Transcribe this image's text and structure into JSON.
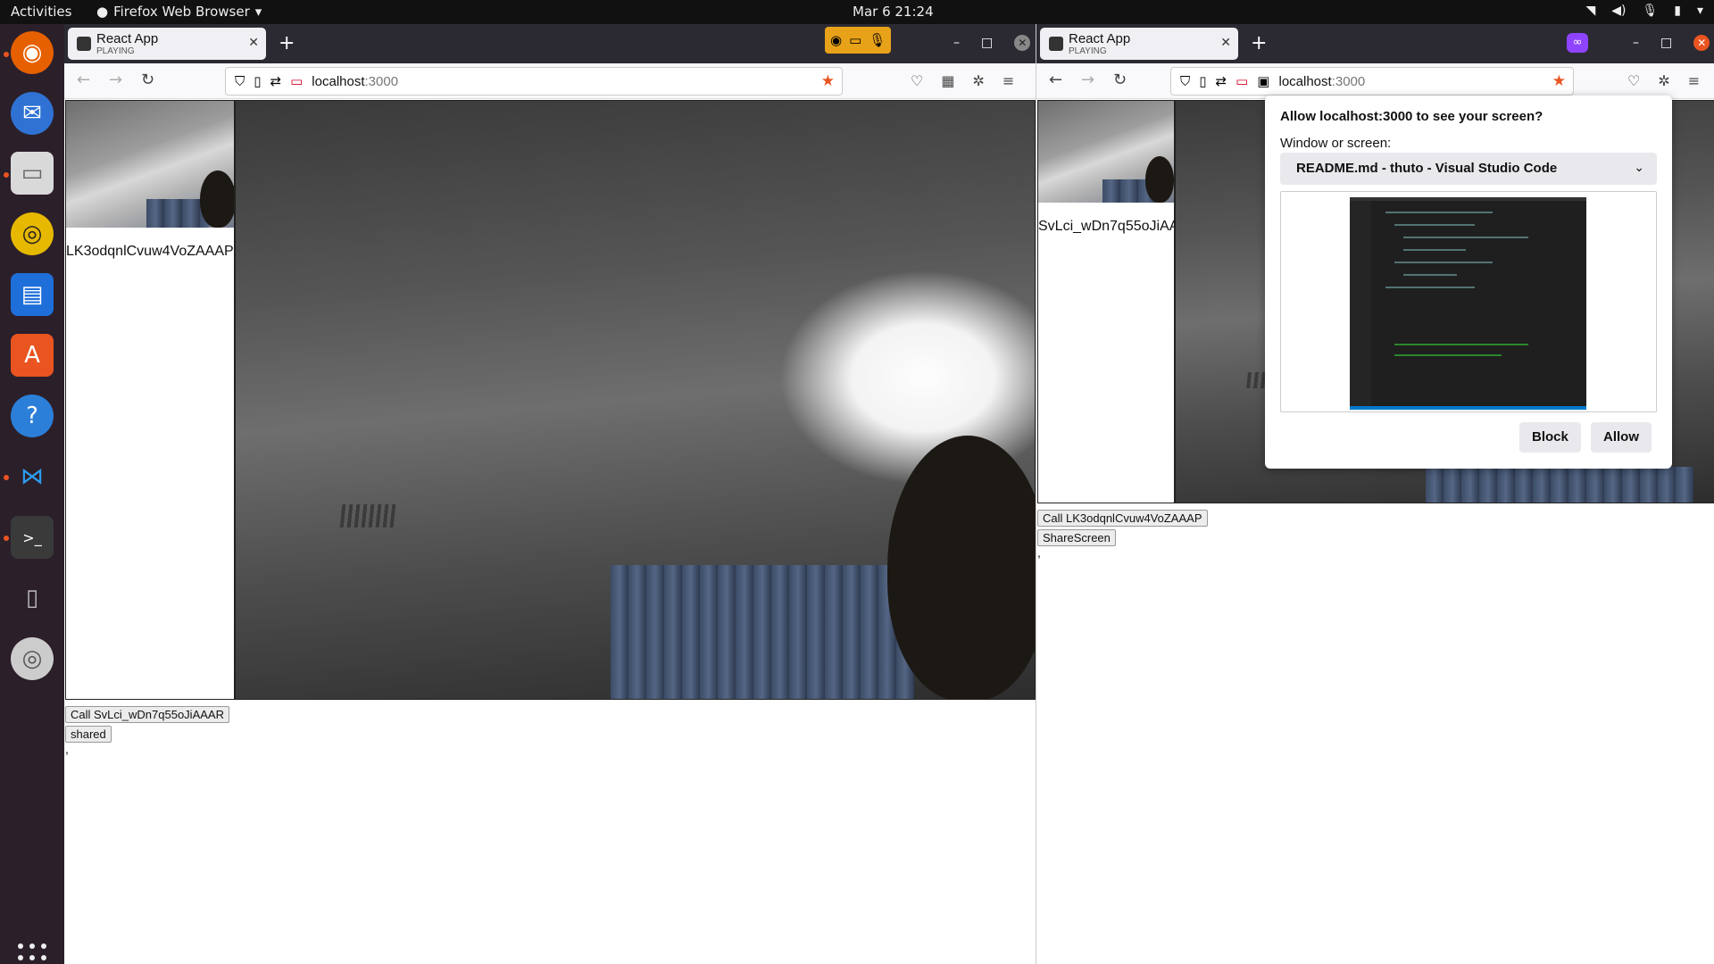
{
  "topbar": {
    "activities": "Activities",
    "app_name": "Firefox Web Browser",
    "clock": "Mar 6  21:24"
  },
  "dock": {
    "items": [
      "firefox-icon",
      "thunderbird-icon",
      "files-icon",
      "rhythmbox-icon",
      "writer-icon",
      "app-center-icon",
      "help-icon",
      "vscode-icon",
      "terminal-icon",
      "removable-drive-icon",
      "dvd-icon"
    ]
  },
  "left_window": {
    "tab": {
      "title": "React App",
      "status": "PLAYING"
    },
    "url": {
      "host": "localhost",
      "port": ":3000"
    },
    "peer_id_label": "LK3odqnlCvuw4VoZAAAP",
    "call_button": "Call SvLci_wDn7q55oJiAAAR",
    "shared_button": "shared",
    "comma": ","
  },
  "right_window": {
    "tab": {
      "title": "React App",
      "status": "PLAYING"
    },
    "url": {
      "host": "localhost",
      "port": ":3000"
    },
    "peer_id_label": "SvLci_wDn7q55oJiAA",
    "call_button": "Call LK3odqnlCvuw4VoZAAAP",
    "share_button": "ShareScreen",
    "comma": ","
  },
  "share_dialog": {
    "title": "Allow localhost:3000 to see your screen?",
    "label": "Window or screen:",
    "selected": "README.md - thuto - Visual Studio Code",
    "block": "Block",
    "allow": "Allow"
  }
}
